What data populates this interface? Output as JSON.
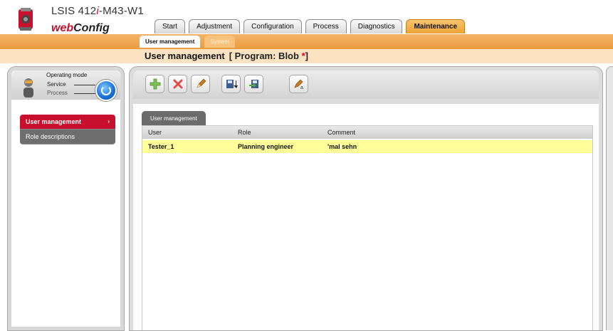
{
  "header": {
    "device_prefix": "LSIS 412",
    "device_i": "i",
    "device_suffix": "-M43-W1",
    "brand_web": "web",
    "brand_config": "Config"
  },
  "tabs": [
    {
      "label": "Start"
    },
    {
      "label": "Adjustment"
    },
    {
      "label": "Configuration"
    },
    {
      "label": "Process"
    },
    {
      "label": "Diagnostics"
    },
    {
      "label": "Maintenance"
    }
  ],
  "subtabs": [
    {
      "label": "User management"
    },
    {
      "label": "System"
    }
  ],
  "page": {
    "title": "User management",
    "program_prefix": "[ Program: Blob ",
    "program_star": "*",
    "program_suffix": "]"
  },
  "operating_mode": {
    "title": "Operating mode",
    "service": "Service",
    "process": "Process"
  },
  "menu": [
    {
      "label": "User management",
      "arrow": "›"
    },
    {
      "label": "Role descriptions"
    }
  ],
  "toolbar": {
    "icons": [
      "add-user-icon",
      "delete-user-icon",
      "edit-user-icon",
      "import-icon",
      "export-icon",
      "change-password-icon"
    ]
  },
  "table": {
    "tab_label": "User management",
    "headers": [
      "User",
      "Role",
      "Comment"
    ],
    "rows": [
      {
        "user": "Tester_1",
        "role": "Planning engineer",
        "comment": "'mal sehn"
      }
    ]
  },
  "colors": {
    "accent_orange": "#ec9b3e",
    "active_red": "#c8102e",
    "row_highlight": "#ffff99"
  }
}
